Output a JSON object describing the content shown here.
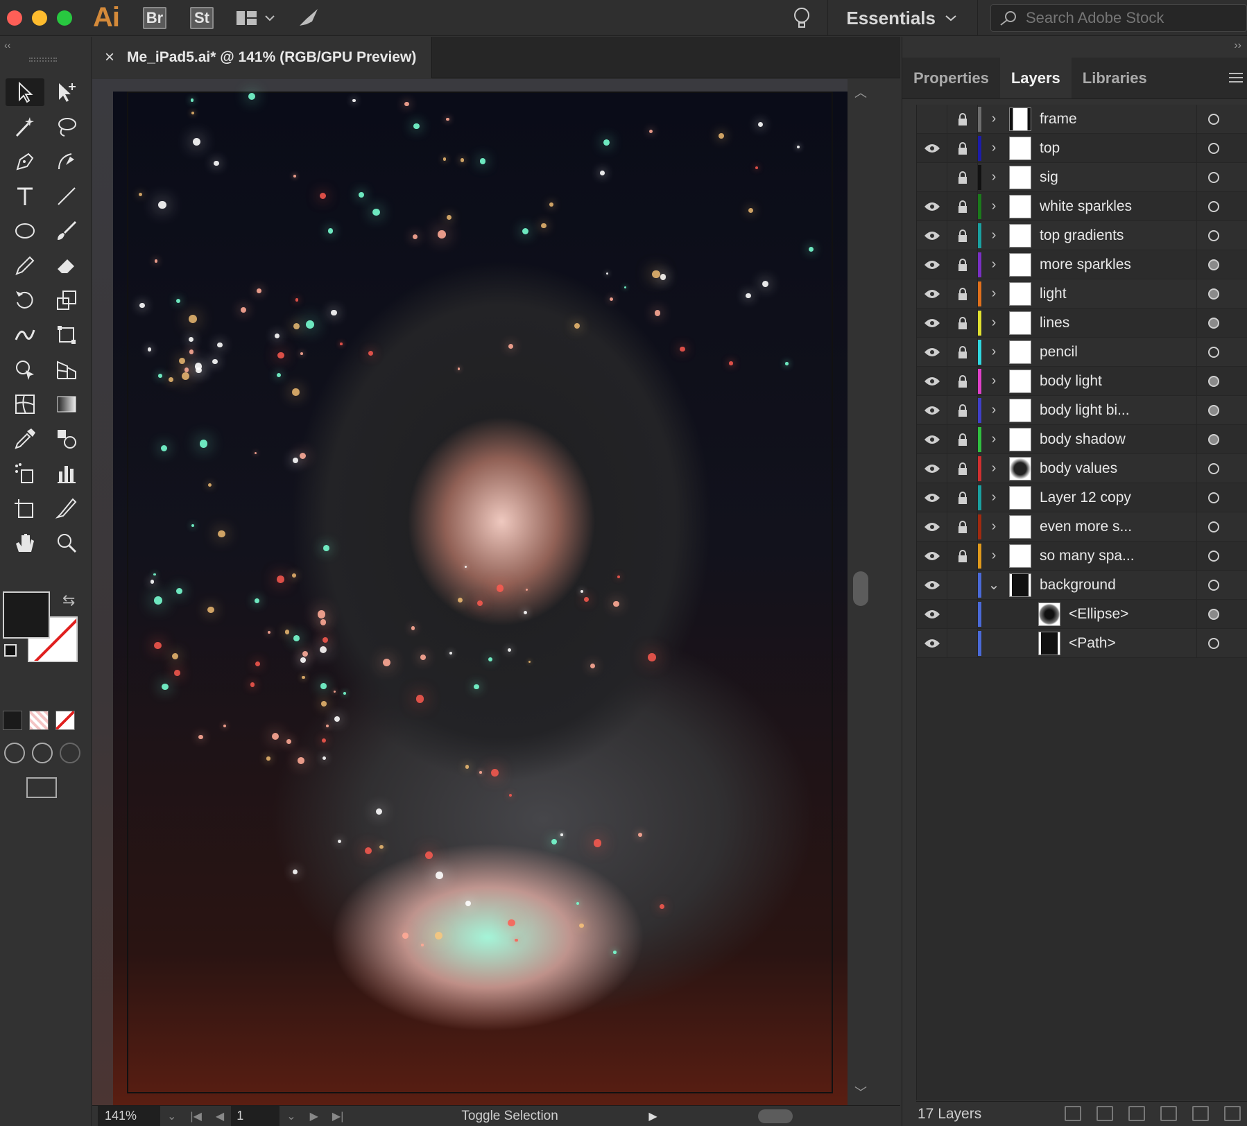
{
  "app": {
    "logo": "Ai",
    "bridge": "Br",
    "stock": "St",
    "workspace": "Essentials",
    "search_placeholder": "Search Adobe Stock"
  },
  "document": {
    "tab_title": "Me_iPad5.ai* @ 141% (RGB/GPU Preview)"
  },
  "status": {
    "zoom": "141%",
    "page": "1",
    "toggle": "Toggle Selection"
  },
  "panel": {
    "tabs": [
      "Properties",
      "Layers",
      "Libraries"
    ],
    "active_tab": "Layers",
    "layer_count": "17 Layers",
    "layers": [
      {
        "name": "frame",
        "visible": false,
        "color": "#6e6e6e",
        "expanded": false
      },
      {
        "name": "top",
        "visible": true,
        "color": "#1c1ca8",
        "expanded": false
      },
      {
        "name": "sig",
        "visible": false,
        "color": "#111111",
        "expanded": false
      },
      {
        "name": "white sparkles",
        "visible": true,
        "color": "#1b7a1b",
        "expanded": false
      },
      {
        "name": "top gradients",
        "visible": true,
        "color": "#1aa0a0",
        "expanded": false
      },
      {
        "name": "more sparkles",
        "visible": true,
        "color": "#7a2fc4",
        "expanded": false
      },
      {
        "name": "light",
        "visible": true,
        "color": "#e0701c",
        "expanded": false
      },
      {
        "name": "lines",
        "visible": true,
        "color": "#e0e030",
        "expanded": false
      },
      {
        "name": "pencil",
        "visible": true,
        "color": "#30d8e0",
        "expanded": false
      },
      {
        "name": "body light",
        "visible": true,
        "color": "#e040c8",
        "expanded": false
      },
      {
        "name": "body light bi...",
        "visible": true,
        "color": "#4040c8",
        "expanded": false
      },
      {
        "name": "body shadow",
        "visible": true,
        "color": "#30c040",
        "expanded": false
      },
      {
        "name": "body values",
        "visible": true,
        "color": "#d03030",
        "expanded": false
      },
      {
        "name": "Layer 12 copy",
        "visible": true,
        "color": "#1aa0a0",
        "expanded": false
      },
      {
        "name": "even more s...",
        "visible": true,
        "color": "#a02a10",
        "expanded": false
      },
      {
        "name": "so many spa...",
        "visible": true,
        "color": "#e09a1c",
        "expanded": false
      },
      {
        "name": "background",
        "visible": true,
        "color": "#4a6ad8",
        "expanded": true
      },
      {
        "name": "<Ellipse>",
        "visible": true,
        "color": "#4a6ad8",
        "sub": true
      },
      {
        "name": "<Path>",
        "visible": true,
        "color": "#4a6ad8",
        "sub": true
      }
    ]
  }
}
